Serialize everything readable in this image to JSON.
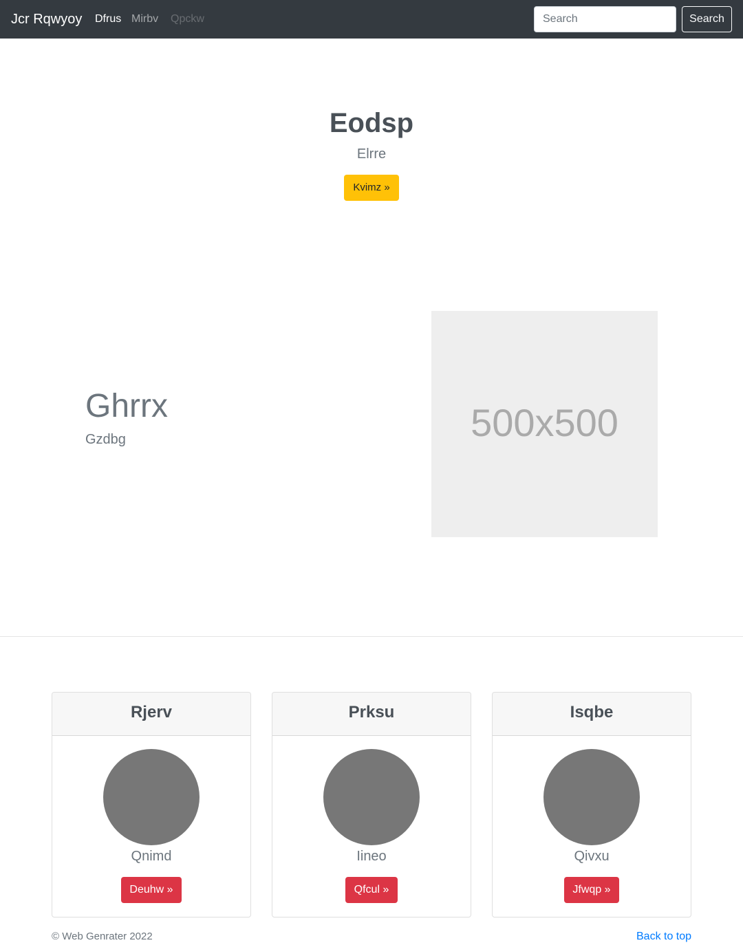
{
  "navbar": {
    "brand": "Jcr Rqwyoy",
    "links": [
      "Dfrus",
      "Mirbv",
      "Qpckw"
    ],
    "search_placeholder": "Search",
    "search_button": "Search"
  },
  "hero": {
    "title": "Eodsp",
    "subtitle": "Elrre",
    "button": "Kvimz »"
  },
  "feature": {
    "heading": "Ghrrx",
    "subheading": "Gzdbg",
    "image_label": "500x500"
  },
  "cards": [
    {
      "title": "Rjerv",
      "name": "Qnimd",
      "button": "Deuhw »"
    },
    {
      "title": "Prksu",
      "name": "Iineo",
      "button": "Qfcul »"
    },
    {
      "title": "Isqbe",
      "name": "Qivxu",
      "button": "Jfwqp »"
    }
  ],
  "footer": {
    "copyright": "© Web Genrater 2022",
    "back_to_top": "Back to top"
  },
  "colors": {
    "navbar_bg": "#343a40",
    "warning": "#ffc107",
    "danger": "#dc3545",
    "link": "#007bff"
  }
}
